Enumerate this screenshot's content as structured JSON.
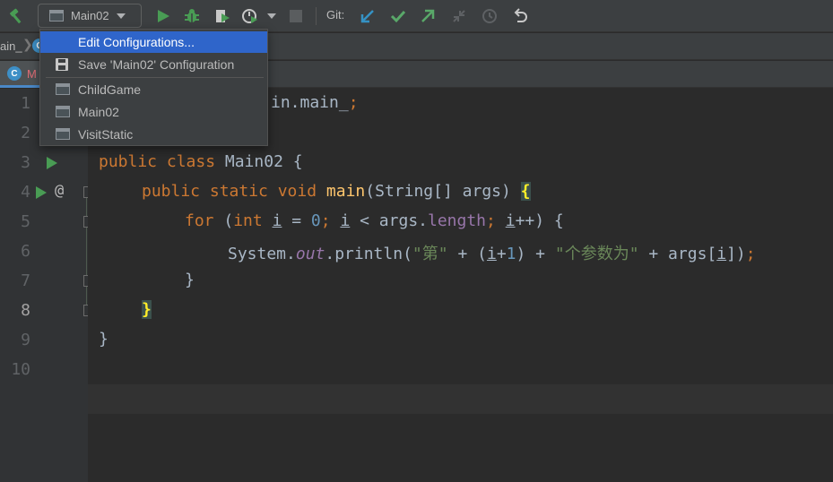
{
  "toolbar": {
    "run_config": "Main02",
    "git_label": "Git:",
    "colors": {
      "run_green": "#499c54",
      "git_blue": "#3592c4",
      "git_green": "#59a869"
    },
    "icons": [
      "build-hammer-icon",
      "run-icon",
      "debug-icon",
      "coverage-icon",
      "profile-icon",
      "more-run-options-icon",
      "stop-icon",
      "git-update-icon",
      "git-commit-icon",
      "git-push-icon",
      "git-compare-icon",
      "git-history-icon",
      "git-rollback-icon"
    ]
  },
  "breadcrumb": {
    "text": "ain_"
  },
  "tabs": [
    {
      "label": "M",
      "icon": "java-class-icon"
    }
  ],
  "dropdown": {
    "items": [
      {
        "label": "Edit Configurations...",
        "selected": true,
        "icon": ""
      },
      {
        "label": "Save 'Main02' Configuration",
        "selected": false,
        "icon": "save-icon"
      },
      {
        "label": "ChildGame",
        "selected": false,
        "icon": "application-config-icon"
      },
      {
        "label": "Main02",
        "selected": false,
        "icon": "application-config-icon"
      },
      {
        "label": "VisitStatic",
        "selected": false,
        "icon": "application-config-icon"
      }
    ]
  },
  "editor": {
    "line_numbers": [
      "1",
      "2",
      "3",
      "4",
      "5",
      "6",
      "7",
      "8",
      "9",
      "10"
    ],
    "current_line": "8",
    "gutter_marks": {
      "override_marker": "@"
    },
    "colors": {
      "keyword": "#cc7832",
      "function": "#ffc66d",
      "number": "#6897bb",
      "string": "#6a8759",
      "field": "#9876aa",
      "text": "#a9b7c6",
      "brace_highlight": "#ffef28"
    },
    "code": {
      "l1_visible": "in.main_",
      "l1_semi": ";",
      "l3_kw": "public class",
      "l3_name": " Main02 {",
      "l4_kw": "public static void",
      "l4_fn": "main",
      "l4_args": "(String[] args) ",
      "brace_open": "{",
      "l5_for": "for",
      "l5_paren": " (",
      "l5_int": "int",
      "l5_i1": "i",
      "l5_eq": " = ",
      "l5_zero": "0",
      "l5_semi1": "; ",
      "l5_i2": "i",
      "l5_lt": " < args.",
      "l5_length": "length",
      "l5_semi2": "; ",
      "l5_i3": "i",
      "l5_end": "++) {",
      "l6_sys": "System.",
      "l6_out": "out",
      "l6_println": ".println(",
      "l6_s1": "\"第\"",
      "l6_plus1": " + (",
      "l6_i1": "i",
      "l6_plus2": "+",
      "l6_one": "1",
      "l6_close": ") + ",
      "l6_s2": "\"个参数为\"",
      "l6_plus3": " + args[",
      "l6_i2": "i",
      "l6_end": "])",
      "l6_semi": ";",
      "l7": "}",
      "brace_close": "}",
      "l9": "}"
    }
  }
}
